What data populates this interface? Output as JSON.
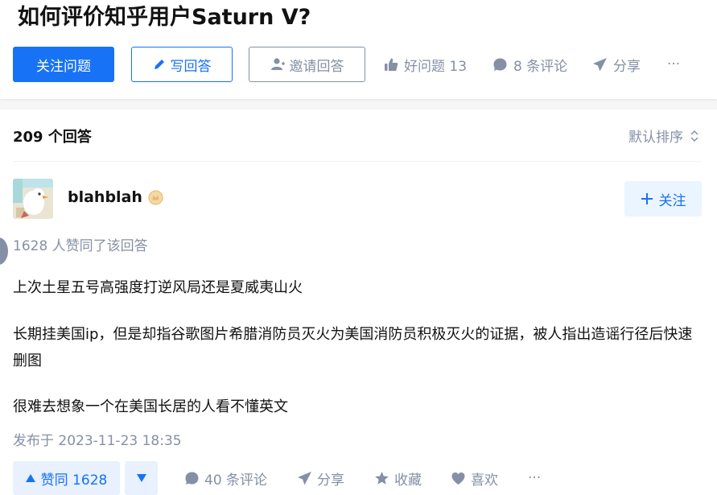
{
  "question": {
    "title": "如何评价知乎用户Saturn V?",
    "follow_label": "关注问题",
    "write_label": "写回答",
    "invite_label": "邀请回答",
    "good_question_label": "好问题 13",
    "comments_label": "8 条评论",
    "share_label": "分享",
    "more_label": "···"
  },
  "answers": {
    "count_label": "209 个回答",
    "sort_label": "默认排序"
  },
  "answer": {
    "author": "blahblah",
    "follow_label": "关注",
    "voters_label": "1628 人赞同了该回答",
    "paragraphs": [
      "上次土星五号高强度打逆风局还是夏威夷山火",
      "长期挂美国ip，但是却指谷歌图片希腊消防员灭火为美国消防员积极灭火的证据，被人指出造谣行径后快速删图",
      "很难去想象一个在美国长居的人看不懂英文"
    ],
    "published": "发布于 2023-11-23 18:35",
    "vote_label": "赞同 1628",
    "comments_label": "40 条评论",
    "share_label": "分享",
    "collect_label": "收藏",
    "like_label": "喜欢",
    "more_label": "···"
  },
  "colors": {
    "brand": "#1772f6",
    "secondary_text": "#8590a6",
    "badge": "#e6b96d"
  }
}
